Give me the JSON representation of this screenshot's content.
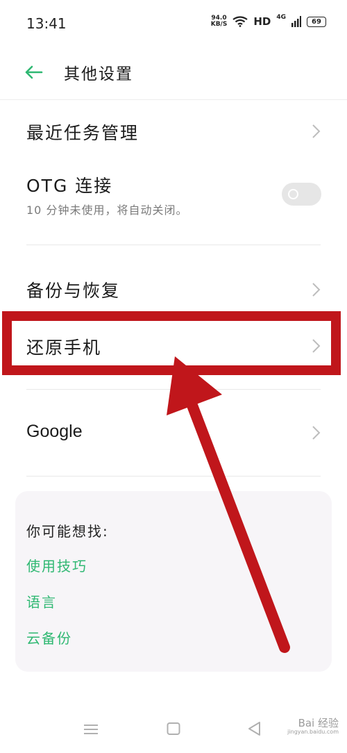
{
  "status_bar": {
    "time": "13:41",
    "speed_value": "94.0",
    "speed_unit": "KB/S",
    "hd": "HD",
    "network": "4G",
    "battery": "69"
  },
  "header": {
    "title": "其他设置"
  },
  "settings": {
    "recent_tasks": "最近任务管理",
    "otg_label": "OTG 连接",
    "otg_sub": "10 分钟未使用，将自动关闭。",
    "otg_enabled": false,
    "backup": "备份与恢复",
    "reset_phone": "还原手机",
    "google": "Google"
  },
  "suggestions": {
    "title": "你可能想找:",
    "links": [
      "使用技巧",
      "语言",
      "云备份"
    ]
  },
  "watermark": {
    "text": "Bai 经验",
    "url": "jingyan.baidu.com"
  },
  "colors": {
    "accent": "#2fb872",
    "annotation": "#c0161b"
  }
}
